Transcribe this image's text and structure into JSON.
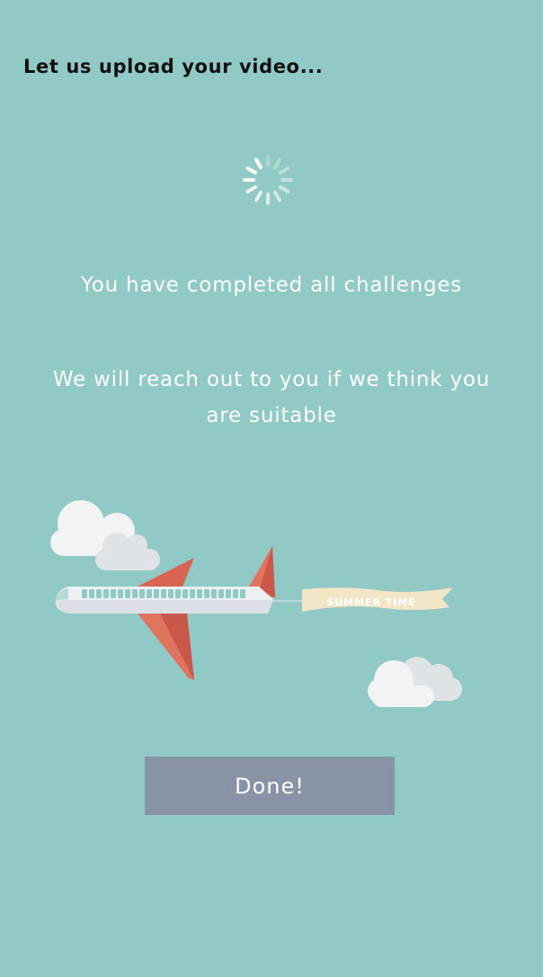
{
  "header": {
    "title": "Let us upload your video..."
  },
  "status": {
    "spinner_icon": "loading-spinner-icon"
  },
  "messages": {
    "completed": "You have completed all challenges",
    "follow_up": "We will reach out to you if we think you are suitable"
  },
  "illustration": {
    "banner_text": "SUMMER TIME",
    "icons": [
      "cloud-icon",
      "airplane-icon",
      "banner-icon"
    ]
  },
  "actions": {
    "done_label": "Done!"
  },
  "colors": {
    "background": "#90c9c5",
    "button": "#8893a5",
    "plane_wing": "#e0735e",
    "plane_body": "#ecf0f2",
    "banner": "#f2e6c6",
    "cloud": "#f1f3f5"
  }
}
